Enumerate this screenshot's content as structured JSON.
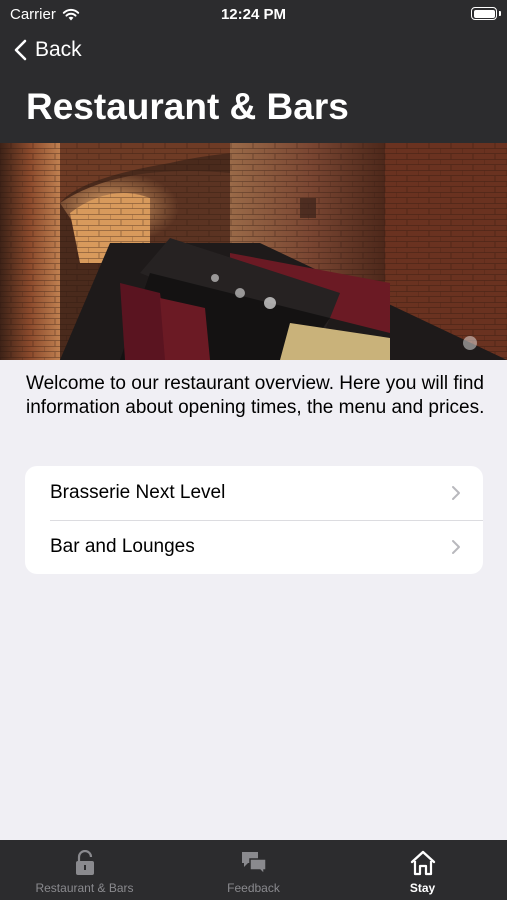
{
  "status_bar": {
    "carrier": "Carrier",
    "time": "12:24 PM"
  },
  "nav": {
    "back_label": "Back",
    "title": "Restaurant & Bars"
  },
  "intro_text": "Welcome to our restaurant overview. Here you will find information about opening times, the menu and prices.",
  "list": {
    "items": [
      {
        "label": "Brasserie Next Level"
      },
      {
        "label": "Bar and Lounges"
      }
    ]
  },
  "tab_bar": {
    "tabs": [
      {
        "label": "Restaurant & Bars",
        "icon": "lock-icon",
        "active": false
      },
      {
        "label": "Feedback",
        "icon": "chat-bubbles-icon",
        "active": false
      },
      {
        "label": "Stay",
        "icon": "home-icon",
        "active": true
      }
    ]
  },
  "colors": {
    "header_bg": "#2c2c2e",
    "page_bg": "#f0eff4",
    "tab_inactive": "#8a8a8e",
    "tab_active": "#ffffff"
  }
}
